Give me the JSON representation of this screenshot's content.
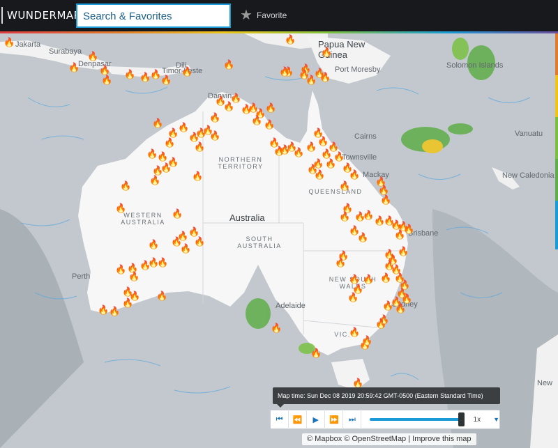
{
  "header": {
    "logo": "WUNDERMAP",
    "search_placeholder": "Search & Favorites",
    "favorite_label": "Favorite"
  },
  "map": {
    "country_label": "Australia",
    "region_labels": [
      "NORTHERN TERRITORY",
      "WESTERN AUSTRALIA",
      "QUEENSLAND",
      "SOUTH AUSTRALIA",
      "NEW SOUTH WALES",
      "VIC."
    ],
    "place_labels": [
      "Jakarta",
      "Surabaya",
      "Denpasar",
      "Dili",
      "Timor-Leste",
      "Papua New Guinea",
      "Port Moresby",
      "Solomon Islands",
      "Vanuatu",
      "New Caledonia",
      "Darwin",
      "Cairns",
      "Townsville",
      "Mackay",
      "Brisbane",
      "Perth",
      "Adelaide",
      "Sydney",
      "New"
    ],
    "fire_icon": "wildfire-icon",
    "fire_count": 240
  },
  "player": {
    "map_time": "Map time: Sun Dec 08 2019 20:59:42 GMT-0500 (Eastern Standard Time)",
    "speed": "1x",
    "progress": 0.94
  },
  "attribution": {
    "mapbox": "© Mapbox",
    "osm": "© OpenStreetMap",
    "separator": "|",
    "improve": "Improve this map"
  },
  "colors": {
    "accent": "#1a9bd7",
    "topbar": "#17191c",
    "land": "#f6f6f6",
    "ocean": "#bfc5ca"
  }
}
